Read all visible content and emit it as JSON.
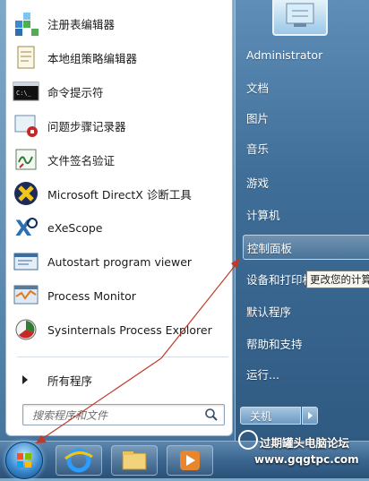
{
  "programs": [
    {
      "label": "注册表编辑器",
      "icon": "registry-editor-icon"
    },
    {
      "label": "本地组策略编辑器",
      "icon": "group-policy-icon"
    },
    {
      "label": "命令提示符",
      "icon": "command-prompt-icon"
    },
    {
      "label": "问题步骤记录器",
      "icon": "steps-recorder-icon"
    },
    {
      "label": "文件签名验证",
      "icon": "file-signature-icon"
    },
    {
      "label": "Microsoft DirectX 诊断工具",
      "icon": "directx-icon"
    },
    {
      "label": "eXeScope",
      "icon": "exescope-icon"
    },
    {
      "label": "Autostart program viewer",
      "icon": "autostart-viewer-icon"
    },
    {
      "label": "Process Monitor",
      "icon": "process-monitor-icon"
    },
    {
      "label": "Sysinternals Process Explorer",
      "icon": "process-explorer-icon"
    }
  ],
  "all_programs": "所有程序",
  "search": {
    "placeholder": "搜索程序和文件"
  },
  "right_pane": {
    "items": [
      {
        "label": "Administrator"
      },
      {
        "label": "文档"
      },
      {
        "label": "图片"
      },
      {
        "label": "音乐"
      },
      {
        "label": "游戏"
      },
      {
        "label": "计算机"
      },
      {
        "label": "控制面板",
        "highlighted": true
      },
      {
        "label": "设备和打印机"
      },
      {
        "label": "默认程序"
      },
      {
        "label": "帮助和支持"
      },
      {
        "label": "运行..."
      }
    ],
    "tooltip": "更改您的计算机",
    "shutdown_label": "关机"
  },
  "taskbar": {
    "buttons": [
      {
        "icon": "internet-explorer-icon"
      },
      {
        "icon": "file-explorer-icon"
      },
      {
        "icon": "media-player-icon"
      }
    ]
  },
  "watermark": {
    "title": "过期罐头电脑论坛",
    "url": "www.gqgtpc.com"
  },
  "colors": {
    "accent": "#3f6e98",
    "annotation": "#c0392b",
    "highlight": "#dbe9f6"
  }
}
